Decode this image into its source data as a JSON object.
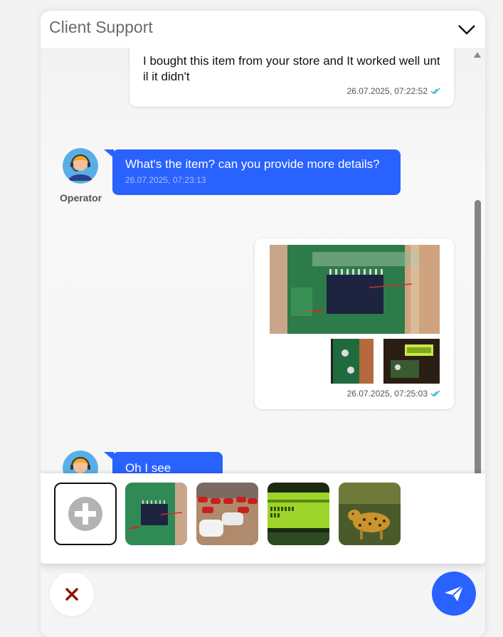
{
  "header": {
    "title": "Client Support",
    "collapse_icon": "chevron-down-icon"
  },
  "messages": [
    {
      "sender": "user",
      "text": "I bought this item from your store and It worked well until it didn't",
      "time": "26.07.2025, 07:22:52",
      "status": "read"
    },
    {
      "sender": "operator",
      "name": "Operator",
      "text": "What's the item? can you provide more details?",
      "time": "26.07.2025, 07:23:13"
    },
    {
      "sender": "user",
      "images": [
        "circuit-board-photo",
        "pcb-photo",
        "lcd-module-photo"
      ],
      "time": "26.07.2025, 07:25:03",
      "status": "read"
    },
    {
      "sender": "operator",
      "text": "Oh I see"
    }
  ],
  "attachments": {
    "add_icon": "plus-icon",
    "thumbnails": [
      "circuit-board",
      "red-cars",
      "green-lcd",
      "leopard"
    ]
  },
  "footer": {
    "cancel_icon": "close-icon",
    "send_icon": "send-icon"
  },
  "colors": {
    "accent": "#2962ff",
    "read_check": "#3fb8d6",
    "cancel": "#8b1a00"
  }
}
